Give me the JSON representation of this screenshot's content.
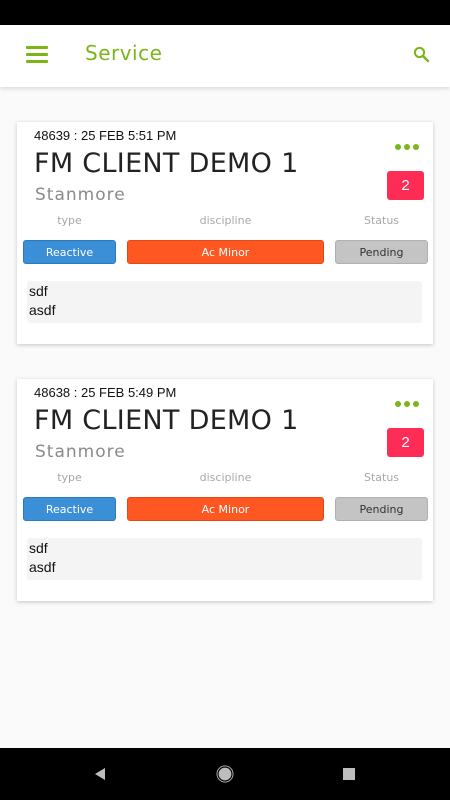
{
  "app": {
    "title": "Service",
    "accent_color": "#7cb518",
    "menu_icon": "hamburger-menu-icon",
    "search_icon": "search-icon"
  },
  "labels": {
    "type": "type",
    "discipline": "discipline",
    "status": "Status"
  },
  "jobs": [
    {
      "header": "48639 : 25 FEB 5:51 PM",
      "client": "FM CLIENT DEMO 1",
      "site": "Stanmore",
      "count": "2",
      "type": "Reactive",
      "discipline": "Ac Minor",
      "status": "Pending",
      "description_lines": [
        "sdf",
        "asdf"
      ]
    },
    {
      "header": "48638 : 25 FEB 5:49 PM",
      "client": "FM CLIENT DEMO 1",
      "site": "Stanmore",
      "count": "2",
      "type": "Reactive",
      "discipline": "Ac Minor",
      "status": "Pending",
      "description_lines": [
        "sdf",
        "asdf"
      ]
    }
  ],
  "colors": {
    "type_pill": "#3b8fd6",
    "discipline_pill": "#ff5722",
    "status_pill": "#c4c4c4",
    "count_badge": "#ff2d55"
  },
  "nav": {
    "back_icon": "back-triangle-icon",
    "home_icon": "home-circle-icon",
    "recents_icon": "recents-square-icon"
  }
}
